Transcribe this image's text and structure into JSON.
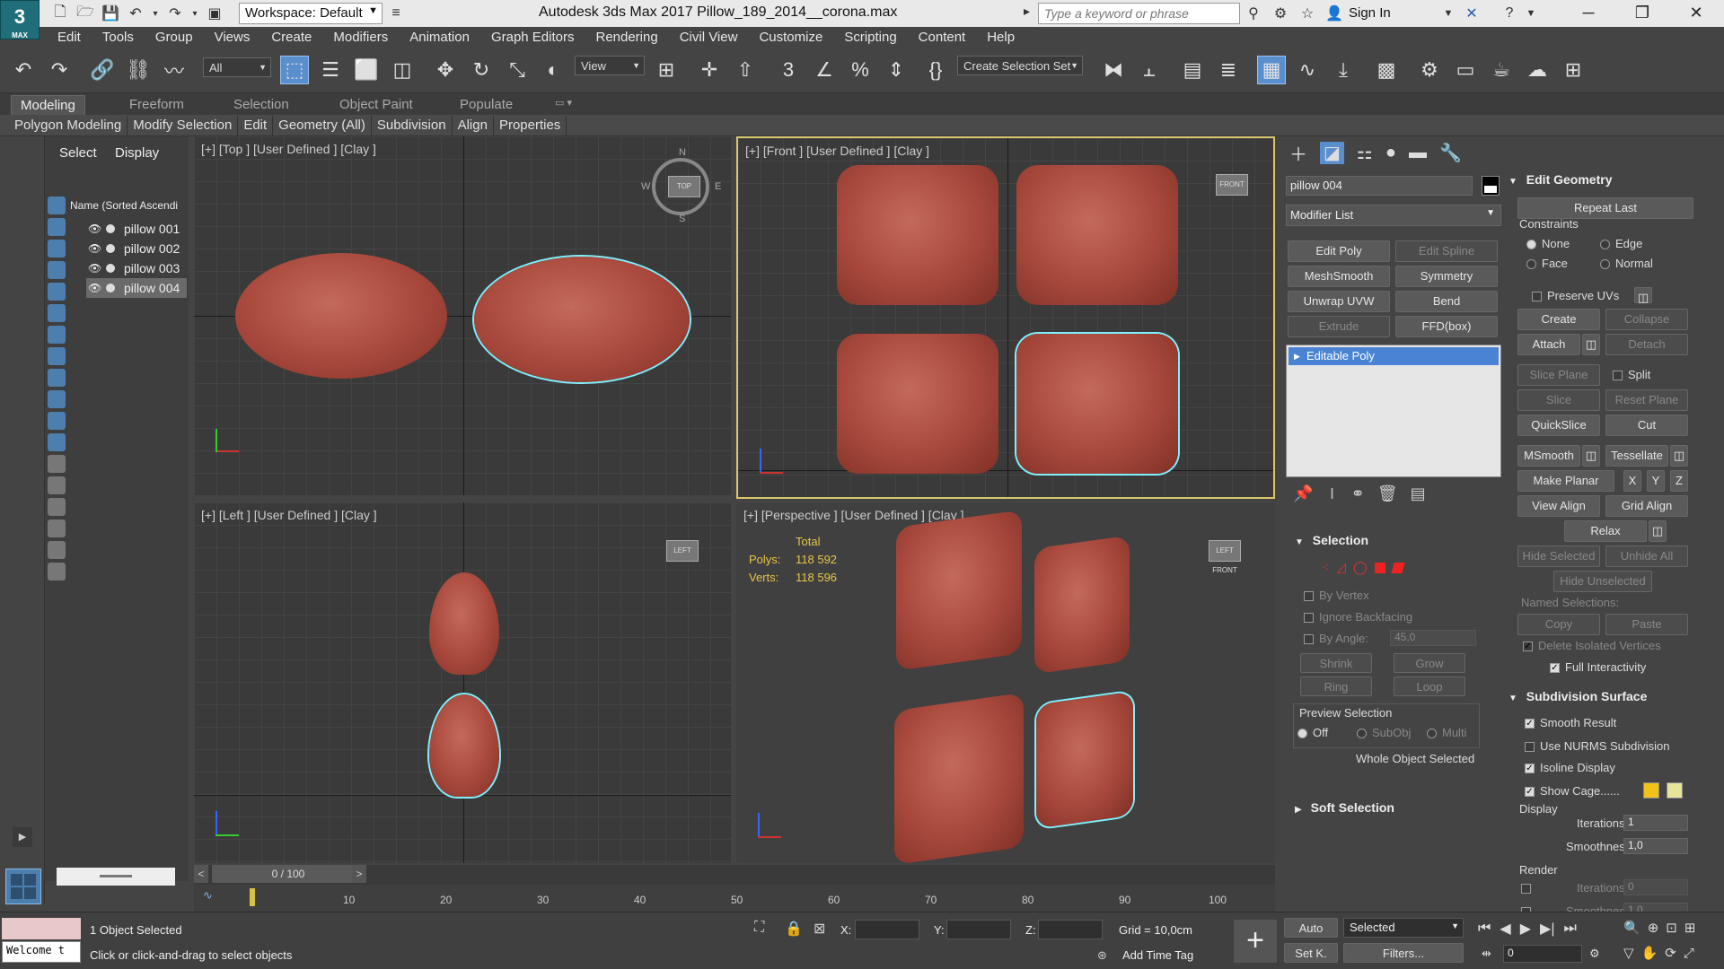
{
  "titlebar": {
    "logo": "3",
    "logo_sub": "MAX",
    "workspace": "Workspace: Default",
    "title": "Autodesk 3ds Max 2017     Pillow_189_2014__corona.max",
    "search_placeholder": "Type a keyword or phrase",
    "sign_in": "Sign In"
  },
  "menu": [
    "Edit",
    "Tools",
    "Group",
    "Views",
    "Create",
    "Modifiers",
    "Animation",
    "Graph Editors",
    "Rendering",
    "Civil View",
    "Customize",
    "Scripting",
    "Content",
    "Help"
  ],
  "toolbar": {
    "filter": "All",
    "ref_coord": "View",
    "selection_set": "Create Selection Set"
  },
  "ribbon": {
    "tabs": [
      "Modeling",
      "Freeform",
      "Selection",
      "Object Paint",
      "Populate"
    ],
    "panels": [
      "Polygon Modeling",
      "Modify Selection",
      "Edit",
      "Geometry (All)",
      "Subdivision",
      "Align",
      "Properties"
    ]
  },
  "explorer": {
    "tabs": [
      "Select",
      "Display"
    ],
    "column_header": "Name (Sorted Ascendi",
    "items": [
      "pillow 001",
      "pillow 002",
      "pillow 003",
      "pillow 004"
    ],
    "selected": "pillow 004"
  },
  "viewports": {
    "top": "[+] [Top ] [User Defined ] [Clay ]",
    "front": "[+] [Front ] [User Defined ] [Clay ]",
    "left": "[+] [Left ] [User Defined ] [Clay ]",
    "perspective": "[+] [Perspective ] [User Defined ] [Clay ]",
    "stats": {
      "total_label": "Total",
      "polys_label": "Polys:",
      "polys": "118 592",
      "verts_label": "Verts:",
      "verts": "118 596"
    },
    "compass": {
      "n": "N",
      "s": "S",
      "e": "E",
      "w": "W",
      "cube": "TOP"
    },
    "cube_front": "FRONT",
    "cube_left": "LEFT",
    "cube_persp": "LEFT FRONT"
  },
  "command_panel": {
    "object_name": "pillow 004",
    "modifier_list": "Modifier List",
    "modifier_buttons": [
      {
        "label": "Edit Poly",
        "enabled": true
      },
      {
        "label": "Edit Spline",
        "enabled": false
      },
      {
        "label": "MeshSmooth",
        "enabled": true
      },
      {
        "label": "Symmetry",
        "enabled": true
      },
      {
        "label": "Unwrap UVW",
        "enabled": true
      },
      {
        "label": "Bend",
        "enabled": true
      },
      {
        "label": "Extrude",
        "enabled": false
      },
      {
        "label": "FFD(box)",
        "enabled": true
      }
    ],
    "stack_item": "Editable Poly",
    "selection": {
      "title": "Selection",
      "by_vertex": "By Vertex",
      "ignore_backfacing": "Ignore Backfacing",
      "by_angle": "By Angle:",
      "angle_value": "45,0",
      "shrink": "Shrink",
      "grow": "Grow",
      "ring": "Ring",
      "loop": "Loop",
      "preview_title": "Preview Selection",
      "preview_off": "Off",
      "preview_subobj": "SubObj",
      "preview_multi": "Multi",
      "status": "Whole Object Selected"
    },
    "soft_selection": "Soft Selection"
  },
  "edit_geometry": {
    "title": "Edit Geometry",
    "repeat_last": "Repeat Last",
    "constraints": "Constraints",
    "c_none": "None",
    "c_edge": "Edge",
    "c_face": "Face",
    "c_normal": "Normal",
    "preserve_uvs": "Preserve UVs",
    "create": "Create",
    "collapse": "Collapse",
    "attach": "Attach",
    "detach": "Detach",
    "slice_plane": "Slice Plane",
    "split": "Split",
    "slice": "Slice",
    "reset_plane": "Reset Plane",
    "quickslice": "QuickSlice",
    "cut": "Cut",
    "msmooth": "MSmooth",
    "tessellate": "Tessellate",
    "make_planar": "Make Planar",
    "x": "X",
    "y": "Y",
    "z": "Z",
    "view_align": "View Align",
    "grid_align": "Grid Align",
    "relax": "Relax",
    "hide_selected": "Hide Selected",
    "unhide_all": "Unhide All",
    "hide_unselected": "Hide Unselected",
    "named_selections": "Named Selections:",
    "copy": "Copy",
    "paste": "Paste",
    "delete_isolated": "Delete Isolated Vertices",
    "full_interactivity": "Full Interactivity"
  },
  "subdivision": {
    "title": "Subdivision Surface",
    "smooth_result": "Smooth Result",
    "use_nurms": "Use NURMS Subdivision",
    "isoline": "Isoline Display",
    "show_cage": "Show Cage......",
    "cage_color1": "#f2c21b",
    "cage_color2": "#e8e49a",
    "display": "Display",
    "iterations_label": "Iterations:",
    "iterations": "1",
    "smoothness_label": "Smoothness:",
    "smoothness": "1,0",
    "render": "Render",
    "render_iterations_label": "Iterations:",
    "render_iterations": "0",
    "render_smoothness_label": "Smoothness:",
    "render_smoothness": "1,0"
  },
  "timeline": {
    "frame": "0 / 100",
    "ticks": [
      "10",
      "20",
      "30",
      "40",
      "50",
      "60",
      "70",
      "80",
      "90",
      "100"
    ]
  },
  "status": {
    "selected": "1 Object Selected",
    "prompt": "Click or click-and-drag to select objects",
    "welcome": "Welcome t",
    "x_label": "X:",
    "y_label": "Y:",
    "z_label": "Z:",
    "grid": "Grid = 10,0cm",
    "add_time_tag": "Add Time Tag",
    "auto": "Auto",
    "set_key": "Set K.",
    "selected_dropdown": "Selected",
    "filters": "Filters...",
    "frame_field": "0"
  },
  "colors": {
    "pillow": "#b04a3e",
    "selection_outline": "#7ef0ff",
    "active_border": "#d9c86a",
    "highlight": "#5a8fcf"
  }
}
